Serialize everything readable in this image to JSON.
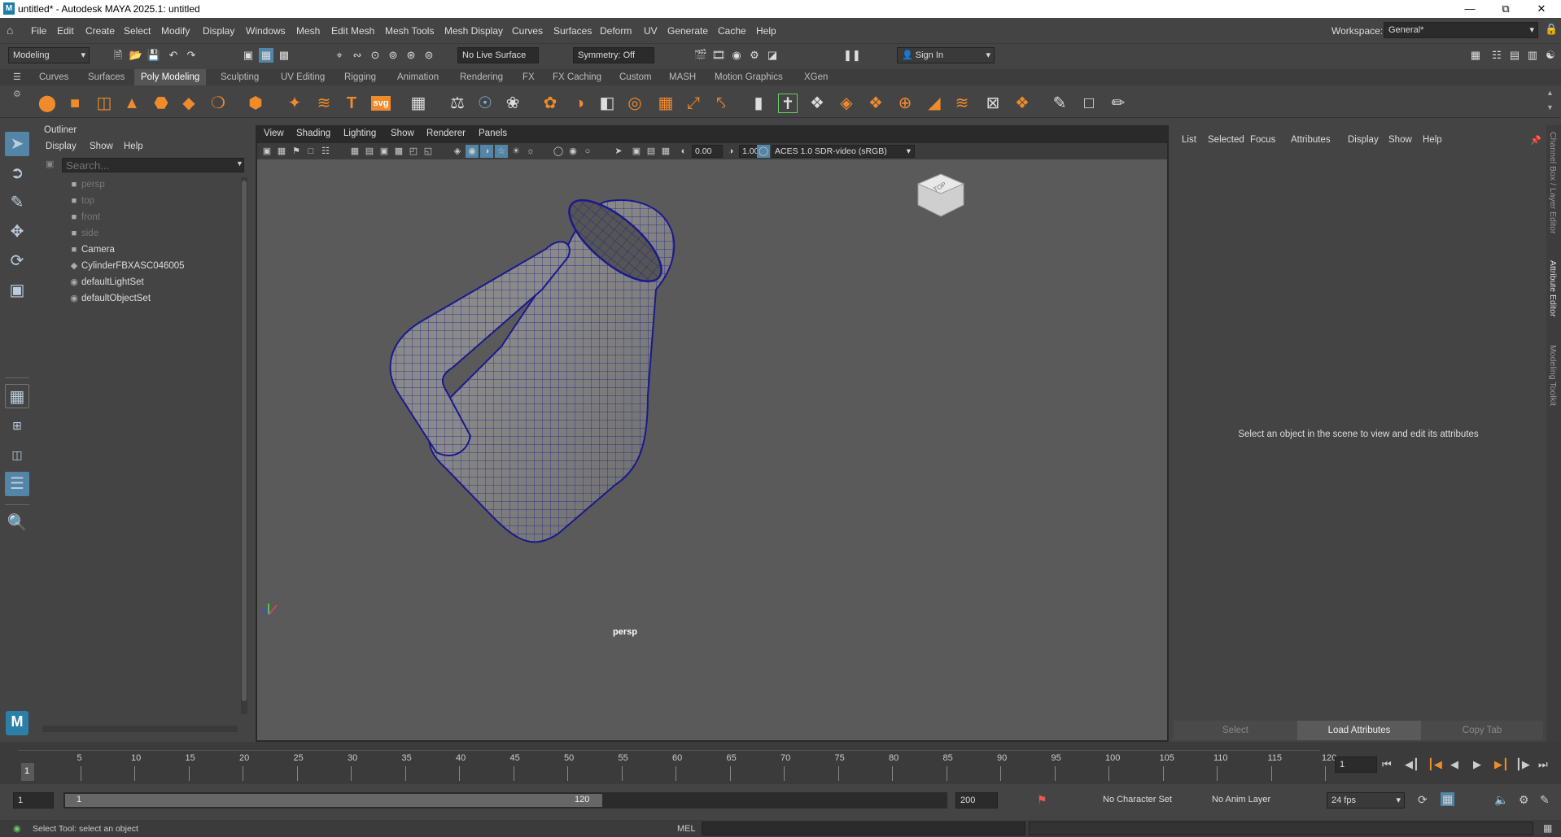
{
  "window": {
    "title": "untitled* - Autodesk MAYA 2025.1: untitled",
    "app_icon": "maya-icon"
  },
  "menubar": {
    "items": [
      "File",
      "Edit",
      "Create",
      "Select",
      "Modify",
      "Display",
      "Windows",
      "Mesh",
      "Edit Mesh",
      "Mesh Tools",
      "Mesh Display",
      "Curves",
      "Surfaces",
      "Deform",
      "UV",
      "Generate",
      "Cache",
      "Help"
    ],
    "workspace_label": "Workspace:",
    "workspace_value": "General*"
  },
  "status_line": {
    "mode": "Modeling",
    "live_surface": "No Live Surface",
    "symmetry": "Symmetry: Off",
    "sign_in": "Sign In"
  },
  "shelf": {
    "tabs": [
      "Curves",
      "Surfaces",
      "Poly Modeling",
      "Sculpting",
      "UV Editing",
      "Rigging",
      "Animation",
      "Rendering",
      "FX",
      "FX Caching",
      "Custom",
      "MASH",
      "Motion Graphics",
      "XGen"
    ],
    "active_tab": "Poly Modeling",
    "svg_label": "svg",
    "text_label": "T"
  },
  "outliner": {
    "title": "Outliner",
    "menus": [
      "Display",
      "Show",
      "Help"
    ],
    "search_placeholder": "Search...",
    "items": [
      {
        "label": "persp",
        "icon": "camera-icon",
        "dim": true
      },
      {
        "label": "top",
        "icon": "camera-icon",
        "dim": true
      },
      {
        "label": "front",
        "icon": "camera-icon",
        "dim": true
      },
      {
        "label": "side",
        "icon": "camera-icon",
        "dim": true
      },
      {
        "label": "Camera",
        "icon": "camera-icon",
        "dim": false
      },
      {
        "label": "CylinderFBXASC046005",
        "icon": "mesh-icon",
        "dim": false
      },
      {
        "label": "defaultLightSet",
        "icon": "set-icon",
        "dim": false
      },
      {
        "label": "defaultObjectSet",
        "icon": "set-icon",
        "dim": false
      }
    ]
  },
  "viewport": {
    "menus": [
      "View",
      "Shading",
      "Lighting",
      "Show",
      "Renderer",
      "Panels"
    ],
    "exposure": "0.00",
    "gamma": "1.00",
    "color_space": "ACES 1.0 SDR-video (sRGB)",
    "camera_label": "persp",
    "viewcube_label": "TOP"
  },
  "attribute_editor": {
    "menus": [
      "List",
      "Selected",
      "Focus",
      "Attributes",
      "Display",
      "Show",
      "Help"
    ],
    "message": "Select an object in the scene to view and edit its attributes",
    "buttons": [
      "Select",
      "Load Attributes",
      "Copy Tab"
    ]
  },
  "side_tabs": [
    "Channel Box / Layer Editor",
    "Attribute Editor",
    "Modeling Toolkit"
  ],
  "timeline": {
    "ticks": [
      "5",
      "10",
      "15",
      "20",
      "25",
      "30",
      "35",
      "40",
      "45",
      "50",
      "55",
      "60",
      "65",
      "70",
      "75",
      "80",
      "85",
      "90",
      "95",
      "100",
      "105",
      "110",
      "115",
      "120"
    ],
    "current_frame": "1",
    "current_frame_field": "1"
  },
  "range": {
    "start": "1",
    "inner_start": "1",
    "inner_end": "120",
    "end": "200",
    "character_set": "No Character Set",
    "anim_layer": "No Anim Layer",
    "fps": "24 fps"
  },
  "status_bar": {
    "help_text": "Select Tool: select an object",
    "cmd_lang": "MEL"
  },
  "colors": {
    "accent_blue": "#5285a6",
    "wire_blue": "#1a1a8c",
    "shelf_orange": "#f08b2c"
  }
}
